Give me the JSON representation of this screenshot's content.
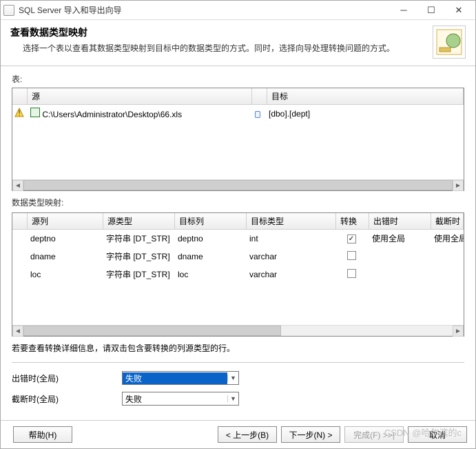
{
  "titlebar": {
    "title": "SQL Server 导入和导出向导"
  },
  "header": {
    "title": "查看数据类型映射",
    "desc": "选择一个表以查看其数据类型映射到目标中的数据类型的方式。同时，选择向导处理转换问题的方式。"
  },
  "table_label": "表:",
  "source_dest_headers": {
    "source": "源",
    "dest": "目标"
  },
  "source_dest_row": {
    "source": "C:\\Users\\Administrator\\Desktop\\66.xls",
    "dest": "[dbo].[dept]"
  },
  "map_label": "数据类型映射:",
  "map_headers": {
    "src_col": "源列",
    "src_type": "源类型",
    "dst_col": "目标列",
    "dst_type": "目标类型",
    "convert": "转换",
    "on_error": "出错时",
    "on_trunc": "截断时"
  },
  "map_rows": [
    {
      "status": "warn",
      "src_col": "deptno",
      "src_type": "字符串 [DT_STR]",
      "dst_col": "deptno",
      "dst_type": "int",
      "convert_checked": true,
      "on_error": "使用全局",
      "on_trunc": "使用全局"
    },
    {
      "status": "ok",
      "src_col": "dname",
      "src_type": "字符串 [DT_STR]",
      "dst_col": "dname",
      "dst_type": "varchar",
      "convert_checked": false,
      "on_error": "",
      "on_trunc": ""
    },
    {
      "status": "ok",
      "src_col": "loc",
      "src_type": "字符串 [DT_STR]",
      "dst_col": "loc",
      "dst_type": "varchar",
      "convert_checked": false,
      "on_error": "",
      "on_trunc": ""
    }
  ],
  "tip": "若要查看转换详细信息，请双击包含要转换的列源类型的行。",
  "form": {
    "on_error_label": "出错时(全局)",
    "on_trunc_label": "截断时(全局)",
    "on_error_value": "失败",
    "on_trunc_value": "失败"
  },
  "footer": {
    "help": "帮助(H)",
    "back": "< 上一步(B)",
    "next": "下一步(N) >",
    "finish": "完成(F) >>|",
    "cancel": "取消"
  },
  "watermark": "CSDN @哈尔滨的c"
}
